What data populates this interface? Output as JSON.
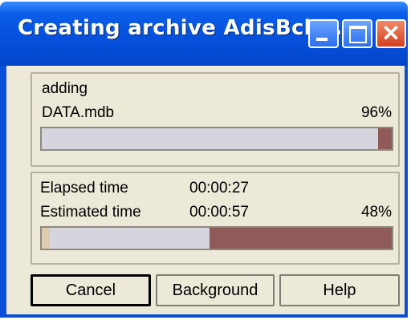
{
  "window": {
    "title": "Creating archive AdisBck...",
    "close_glyph": "✕"
  },
  "current_file": {
    "action": "adding",
    "name": "DATA.mdb",
    "percent_label": "96%",
    "progress": 0.96
  },
  "overall": {
    "elapsed_label": "Elapsed time",
    "elapsed_value": "00:00:27",
    "estimated_label": "Estimated time",
    "estimated_value": "00:00:57",
    "percent_label": "48%",
    "progress": 0.48
  },
  "buttons": {
    "cancel": "Cancel",
    "background": "Background",
    "help": "Help"
  },
  "colors": {
    "progress_fill": "#8f5a58",
    "progress_track": "#d6d4dc"
  }
}
